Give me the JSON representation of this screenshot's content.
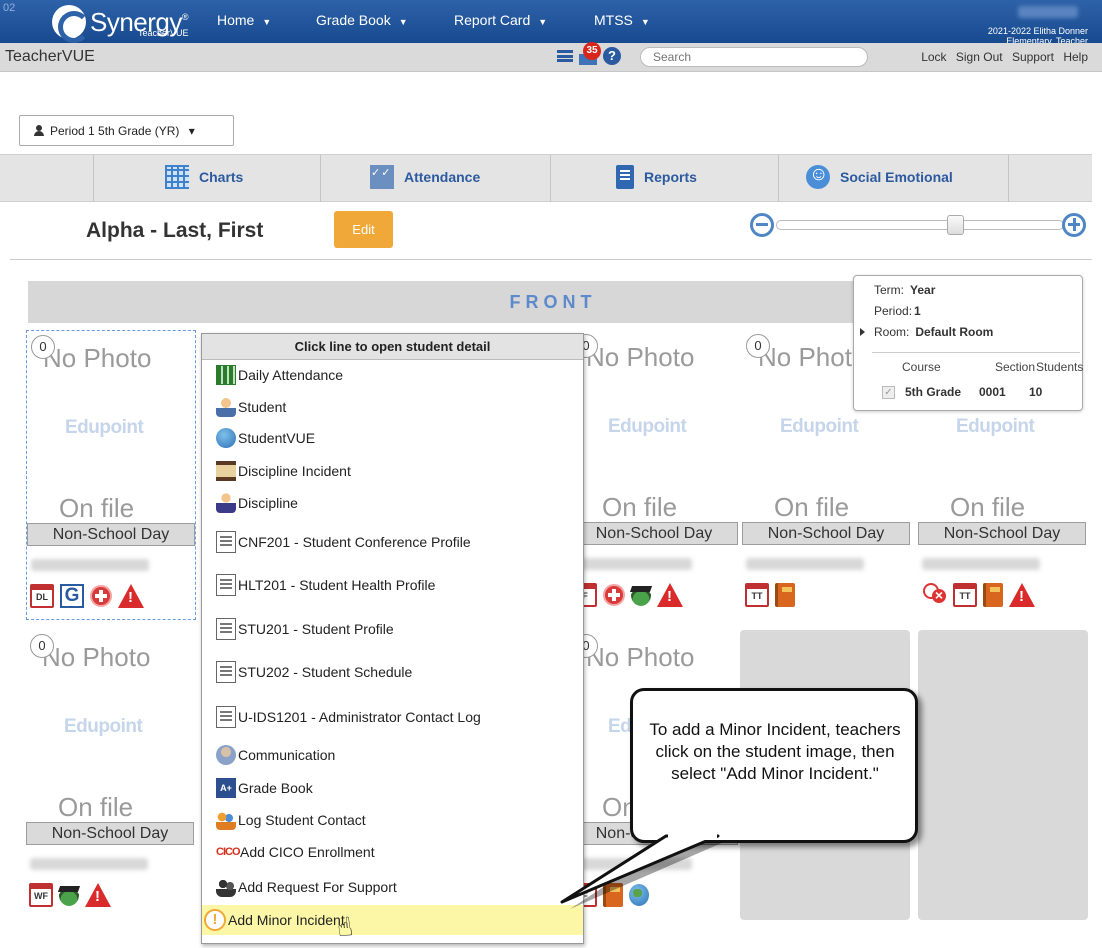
{
  "topbar": {
    "corner_text": "02",
    "brand": "Synergy",
    "brand_reg": "®",
    "product": "TeacherVUE",
    "nav": [
      {
        "label": "Home"
      },
      {
        "label": "Grade Book"
      },
      {
        "label": "Report Card"
      },
      {
        "label": "MTSS"
      }
    ],
    "user_line1": "2021-2022 Elitha Donner",
    "user_line2": "Elementary, Teacher"
  },
  "bar2": {
    "app_name": "TeacherVUE",
    "message_count": "35",
    "help_glyph": "?",
    "search_placeholder": "Search",
    "links": [
      "Lock",
      "Sign Out",
      "Support",
      "Help"
    ]
  },
  "period_selector": {
    "label": "Period 1 5th Grade (YR)",
    "caret": "▾"
  },
  "tabs": [
    {
      "label": "Charts",
      "icon": "grid-icon"
    },
    {
      "label": "Attendance",
      "icon": "attendance-icon"
    },
    {
      "label": "Reports",
      "icon": "report-icon"
    },
    {
      "label": "Social Emotional",
      "icon": "smiley-icon"
    }
  ],
  "chart_header": {
    "title": "Alpha - Last, First",
    "edit_label": "Edit",
    "zoom_level": 0.63
  },
  "front_label": "FRONT",
  "info": {
    "term_label": "Term:",
    "term_value": "Year",
    "period_label": "Period:",
    "period_value": "1",
    "room_label": "Room:",
    "room_value": "Default Room",
    "col_course": "Course",
    "col_section": "Section",
    "col_students": "Students",
    "course": "5th Grade",
    "section": "0001",
    "students": "10",
    "check_glyph": "✓"
  },
  "seat_text": {
    "no_photo": "No Photo",
    "edupoint": "Edupoint",
    "on_file": "On file",
    "status": "Non-School Day",
    "count": "0"
  },
  "seat_icon_labels": {
    "dl": "DL",
    "g": "G",
    "tt": "TT",
    "wf": "WF",
    "f": "F"
  },
  "menu": {
    "title": "Click line to open student detail",
    "items": [
      {
        "label": "Daily Attendance",
        "icon": "daily-attendance-icon"
      },
      {
        "label": "Student",
        "icon": "student-icon"
      },
      {
        "label": "StudentVUE",
        "icon": "studentvue-icon"
      },
      {
        "label": "Discipline Incident",
        "icon": "discipline-incident-icon"
      },
      {
        "label": "Discipline",
        "icon": "discipline-icon"
      },
      {
        "label": "CNF201 - Student Conference Profile",
        "icon": "document-icon"
      },
      {
        "label": "HLT201 - Student Health Profile",
        "icon": "document-icon"
      },
      {
        "label": "STU201 - Student Profile",
        "icon": "document-icon"
      },
      {
        "label": "STU202 - Student Schedule",
        "icon": "document-icon"
      },
      {
        "label": "U-IDS1201 - Administrator Contact Log",
        "icon": "document-icon"
      },
      {
        "label": "Communication",
        "icon": "communication-icon"
      },
      {
        "label": "Grade Book",
        "icon": "gradebook-icon"
      },
      {
        "label": "Log Student Contact",
        "icon": "log-contact-icon"
      },
      {
        "label": "Add CICO Enrollment",
        "icon": "cico-icon"
      },
      {
        "label": "Add Request For Support",
        "icon": "request-support-icon"
      },
      {
        "label": "Add Minor Incident",
        "icon": "minor-incident-icon"
      }
    ],
    "cico_glyph": "CICO",
    "gradebook_glyph": "A+",
    "minor_glyph": "!"
  },
  "callout": {
    "text": "To add a Minor Incident, teachers click on the student image, then select \"Add Minor Incident.\""
  },
  "colors": {
    "brand_blue": "#2e62a8",
    "accent_orange": "#f0a838",
    "highlight_yellow": "#fbf7a6",
    "alert_red": "#d92b2b"
  }
}
